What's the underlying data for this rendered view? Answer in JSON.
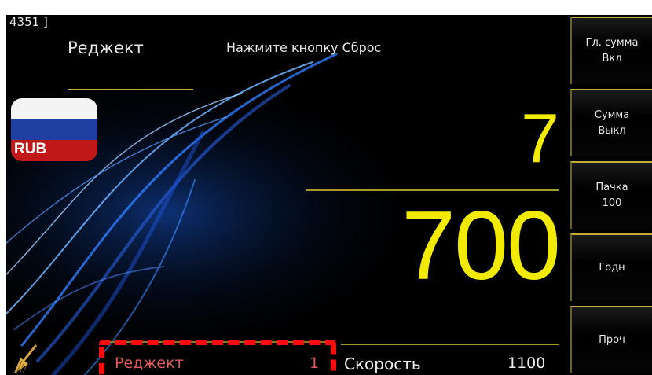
{
  "status": {
    "code": "4351 ]",
    "mode": "Реджект",
    "message": "Нажмите кнопку Сброс"
  },
  "currency": {
    "label": "RUB"
  },
  "counter": {
    "count": "7",
    "amount": "700"
  },
  "bottom": {
    "reject_label": "Реджект",
    "reject_value": "1",
    "speed_label": "Скорость",
    "speed_value": "1100"
  },
  "sidebar": {
    "buttons": [
      {
        "line1": "Гл. сумма",
        "line2": "Вкл"
      },
      {
        "line1": "Сумма",
        "line2": "Выкл"
      },
      {
        "line1": "Пачка",
        "line2": "100"
      },
      {
        "line1": "Годн",
        "line2": ""
      },
      {
        "line1": "Проч",
        "line2": ""
      }
    ]
  },
  "colors": {
    "background": "#000000",
    "accent": "#f2ea00",
    "highlight": "#ff0b0b",
    "reject_text": "#e45a5a"
  }
}
